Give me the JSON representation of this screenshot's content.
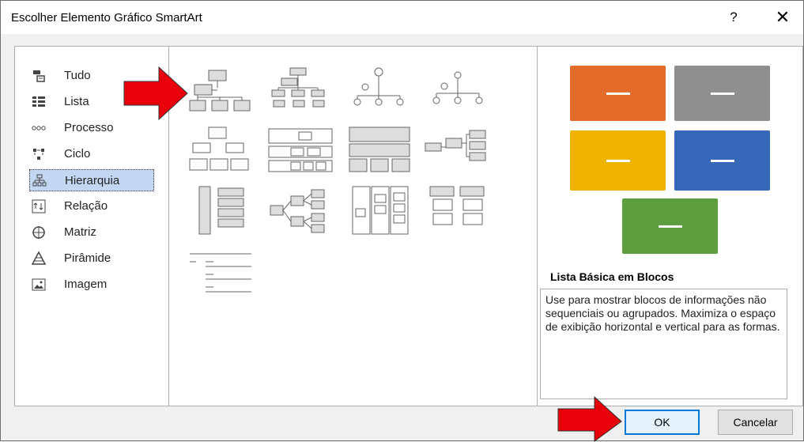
{
  "dialog": {
    "title": "Escolher Elemento Gráfico SmartArt",
    "help_label": "?",
    "close_label": "✕"
  },
  "categories": [
    {
      "label": "Tudo",
      "icon": "all-icon"
    },
    {
      "label": "Lista",
      "icon": "list-icon"
    },
    {
      "label": "Processo",
      "icon": "process-icon"
    },
    {
      "label": "Ciclo",
      "icon": "cycle-icon"
    },
    {
      "label": "Hierarquia",
      "icon": "hierarchy-icon",
      "selected": true
    },
    {
      "label": "Relação",
      "icon": "relationship-icon"
    },
    {
      "label": "Matriz",
      "icon": "matrix-icon"
    },
    {
      "label": "Pirâmide",
      "icon": "pyramid-icon"
    },
    {
      "label": "Imagem",
      "icon": "picture-icon"
    }
  ],
  "preview": {
    "title": "Lista Básica em Blocos",
    "description": "Use para mostrar blocos de informações não sequenciais ou agrupados. Maximiza o espaço de exibição horizontal e vertical para as formas.",
    "block_colors": [
      "#e46c2a",
      "#8f8f8f",
      "#f0b400",
      "#3667b8",
      "#5f9e3f"
    ]
  },
  "buttons": {
    "ok_label": "OK",
    "cancel_label": "Cancelar"
  },
  "annotations": {
    "arrow_color": "#e8000b"
  }
}
